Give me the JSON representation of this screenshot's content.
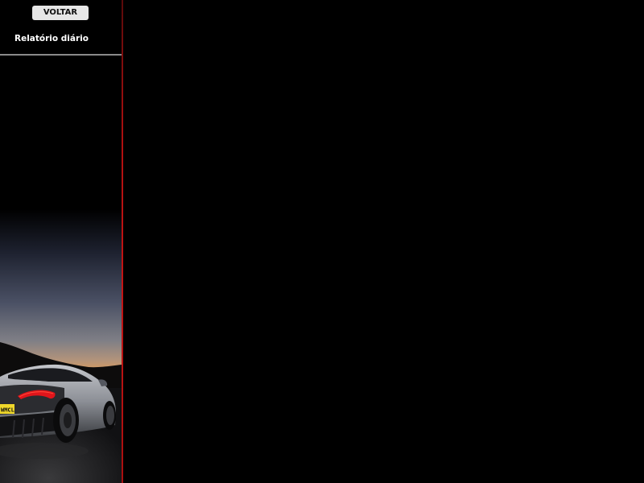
{
  "sidebar": {
    "back_button_label": "VOLTAR",
    "nav_items": [
      {
        "label": "Relatório diário"
      }
    ],
    "accent_color": "#c41414",
    "background_image": {
      "subject": "car-photo",
      "plate_text": "MCL"
    }
  },
  "colors": {
    "background": "#000000",
    "button_bg": "#e6e6e6",
    "text": "#ffffff"
  }
}
